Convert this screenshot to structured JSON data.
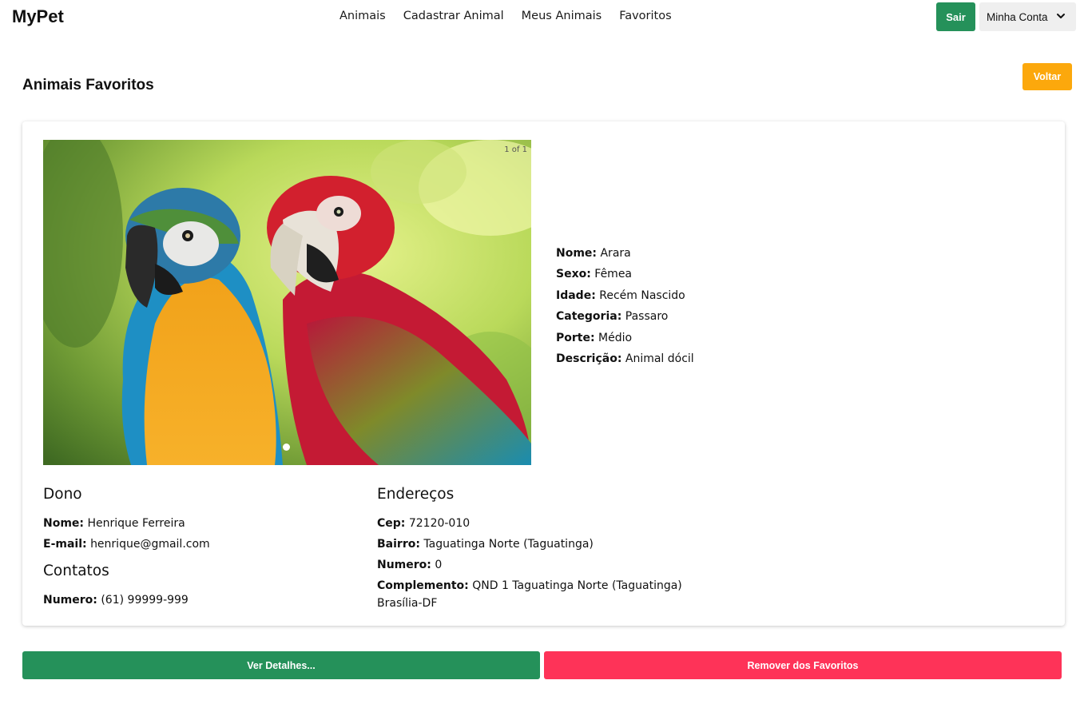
{
  "header": {
    "brand": "MyPet",
    "nav": [
      "Animais",
      "Cadastrar Animal",
      "Meus Animais",
      "Favoritos"
    ],
    "logout_label": "Sair",
    "account_label": "Minha Conta",
    "account_icon": "chevron-down-icon"
  },
  "page": {
    "title": "Animais Favoritos",
    "back_label": "Voltar"
  },
  "animal": {
    "carousel_counter": "1 of 1",
    "fields": [
      {
        "label": "Nome:",
        "value": "Arara"
      },
      {
        "label": "Sexo:",
        "value": "Fêmea"
      },
      {
        "label": "Idade:",
        "value": "Recém Nascido"
      },
      {
        "label": "Categoria:",
        "value": "Passaro"
      },
      {
        "label": "Porte:",
        "value": "Médio"
      },
      {
        "label": "Descrição:",
        "value": "Animal dócil"
      }
    ]
  },
  "owner": {
    "title": "Dono",
    "fields": [
      {
        "label": "Nome:",
        "value": "Henrique Ferreira"
      },
      {
        "label": "E-mail:",
        "value": "henrique@gmail.com"
      }
    ]
  },
  "contacts": {
    "title": "Contatos",
    "fields": [
      {
        "label": "Numero:",
        "value": "(61) 99999-999"
      }
    ]
  },
  "address": {
    "title": "Endereços",
    "fields": [
      {
        "label": "Cep:",
        "value": "72120-010"
      },
      {
        "label": "Bairro:",
        "value": "Taguatinga Norte (Taguatinga)"
      },
      {
        "label": "Numero:",
        "value": "0"
      },
      {
        "label": "Complemento:",
        "value": "QND 1 Taguatinga Norte (Taguatinga)"
      }
    ],
    "city": "Brasília-DF"
  },
  "actions": {
    "details_label": "Ver Detalhes...",
    "remove_label": "Remover dos Favoritos"
  },
  "colors": {
    "primary": "#25915a",
    "warning": "#fca80c",
    "danger": "#fe3358"
  }
}
